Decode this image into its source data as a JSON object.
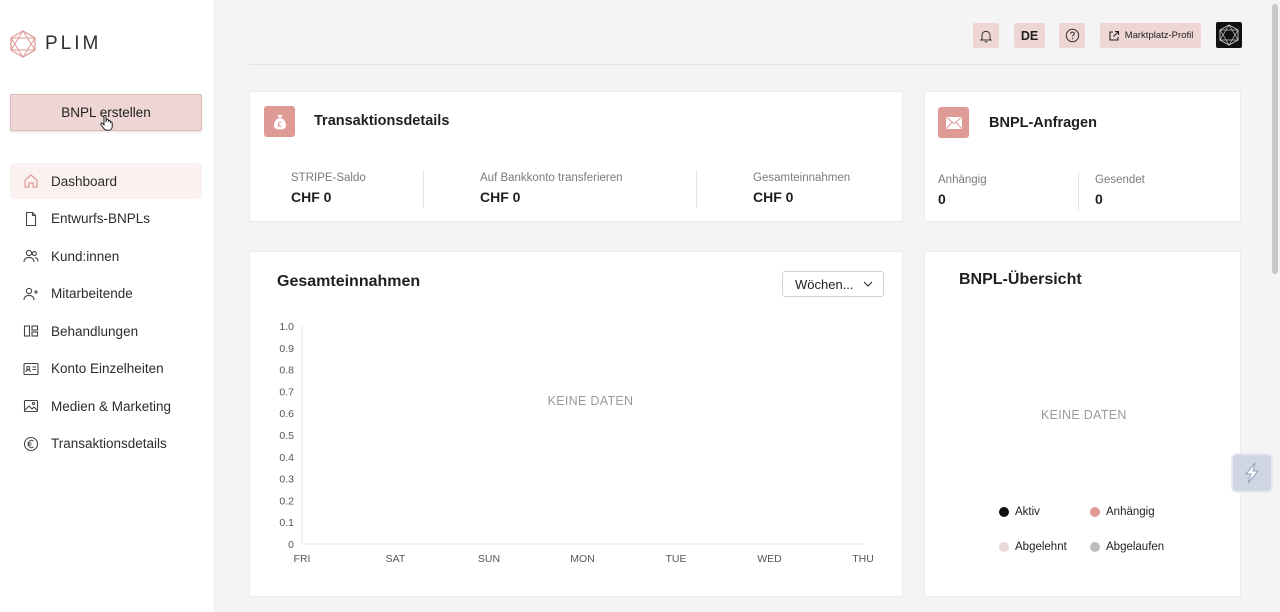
{
  "brand": {
    "name": "PLIM"
  },
  "sidebar": {
    "create_button": "BNPL erstellen",
    "items": [
      {
        "label": "Dashboard",
        "icon": "home-icon",
        "active": true
      },
      {
        "label": "Entwurfs-BNPLs",
        "icon": "file-icon"
      },
      {
        "label": "Kund:innen",
        "icon": "users-icon"
      },
      {
        "label": "Mitarbeitende",
        "icon": "user-plus-icon"
      },
      {
        "label": "Behandlungen",
        "icon": "layout-icon"
      },
      {
        "label": "Konto Einzelheiten",
        "icon": "id-card-icon"
      },
      {
        "label": "Medien & Marketing",
        "icon": "image-icon"
      },
      {
        "label": "Transaktionsdetails",
        "icon": "euro-icon"
      }
    ]
  },
  "topbar": {
    "language": "DE",
    "profile_label": "Marktplatz-Profil"
  },
  "transactions": {
    "title": "Transaktionsdetails",
    "stats": [
      {
        "label": "STRIPE-Saldo",
        "value": "CHF 0"
      },
      {
        "label": "Auf Bankkonto transferieren",
        "value": "CHF 0"
      },
      {
        "label": "Gesamteinnahmen",
        "value": "CHF 0"
      }
    ]
  },
  "requests": {
    "title": "BNPL-Anfragen",
    "stats": [
      {
        "label": "Anhängig",
        "value": "0"
      },
      {
        "label": "Gesendet",
        "value": "0"
      }
    ]
  },
  "revenue": {
    "title": "Gesamteinnahmen",
    "period": "Wöchen...",
    "no_data": "KEINE DATEN"
  },
  "overview": {
    "title": "BNPL-Übersicht",
    "no_data": "KEINE DATEN",
    "legend": [
      {
        "label": "Aktiv",
        "color": "#111111"
      },
      {
        "label": "Anhängig",
        "color": "#df9a96"
      },
      {
        "label": "Abgelehnt",
        "color": "#ecd9d7"
      },
      {
        "label": "Abgelaufen",
        "color": "#bdbdbd"
      }
    ]
  },
  "chart_data": {
    "type": "line",
    "title": "Gesamteinnahmen",
    "categories": [
      "FRI",
      "SAT",
      "SUN",
      "MON",
      "TUE",
      "WED",
      "THU"
    ],
    "y_ticks": [
      "1.0",
      "0.9",
      "0.8",
      "0.7",
      "0.6",
      "0.5",
      "0.4",
      "0.3",
      "0.2",
      "0.1",
      "0"
    ],
    "ylim": [
      0,
      1
    ],
    "series": [],
    "annotation": "KEINE DATEN"
  }
}
